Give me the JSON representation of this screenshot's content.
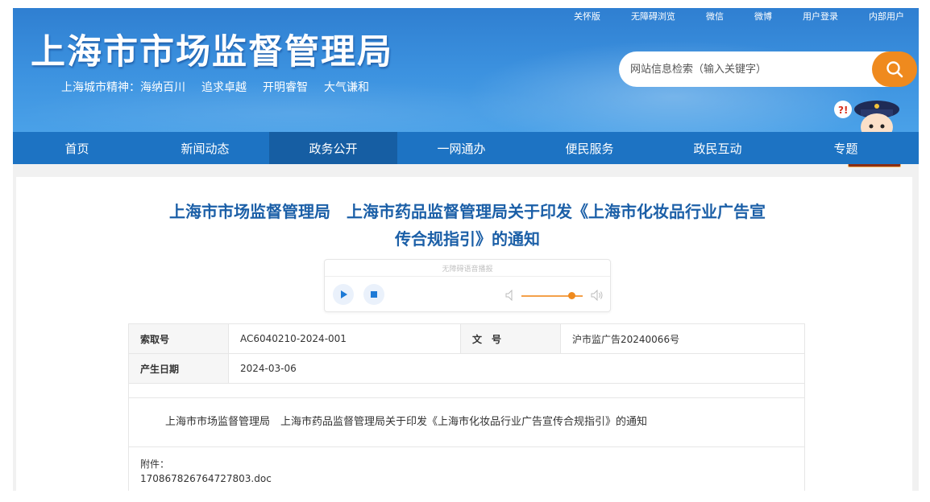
{
  "header": {
    "top_links": [
      "关怀版",
      "无障碍浏览",
      "微信",
      "微博",
      "用户登录",
      "内部用户"
    ],
    "site_title": "上海市市场监督管理局",
    "motto": [
      "上海城市精神：海纳百川",
      "追求卓越",
      "开明睿智",
      "大气谦和"
    ],
    "search_placeholder": "网站信息检索（输入关键字）",
    "assistant_label": "智能客服"
  },
  "nav": {
    "items": [
      "首页",
      "新闻动态",
      "政务公开",
      "一网通办",
      "便民服务",
      "政民互动",
      "专题"
    ],
    "active": "政务公开"
  },
  "article": {
    "title_line1": "上海市市场监督管理局　上海市药品监督管理局关于印发《上海市化妆品行业广告宣",
    "title_line2": "传合规指引》的通知",
    "audio_label": "无障碍语音播报",
    "meta": {
      "index_key": "索取号",
      "index_value": "AC6040210-2024-001",
      "doc_key": "文　号",
      "doc_value": "沪市监广告20240066号",
      "date_key": "产生日期",
      "date_value": "2024-03-06"
    },
    "body_text": "上海市市场监督管理局　上海市药品监督管理局关于印发《上海市化妆品行业广告宣传合规指引》的通知",
    "attachment_label": "附件：",
    "attachment_file": "170867826764727803.doc"
  },
  "colors": {
    "header_blue": "#2f7fd1",
    "nav_blue": "#1d73c3",
    "nav_active": "#165ea3",
    "title_blue": "#1b5fa7",
    "accent_orange": "#ef8a1e"
  }
}
